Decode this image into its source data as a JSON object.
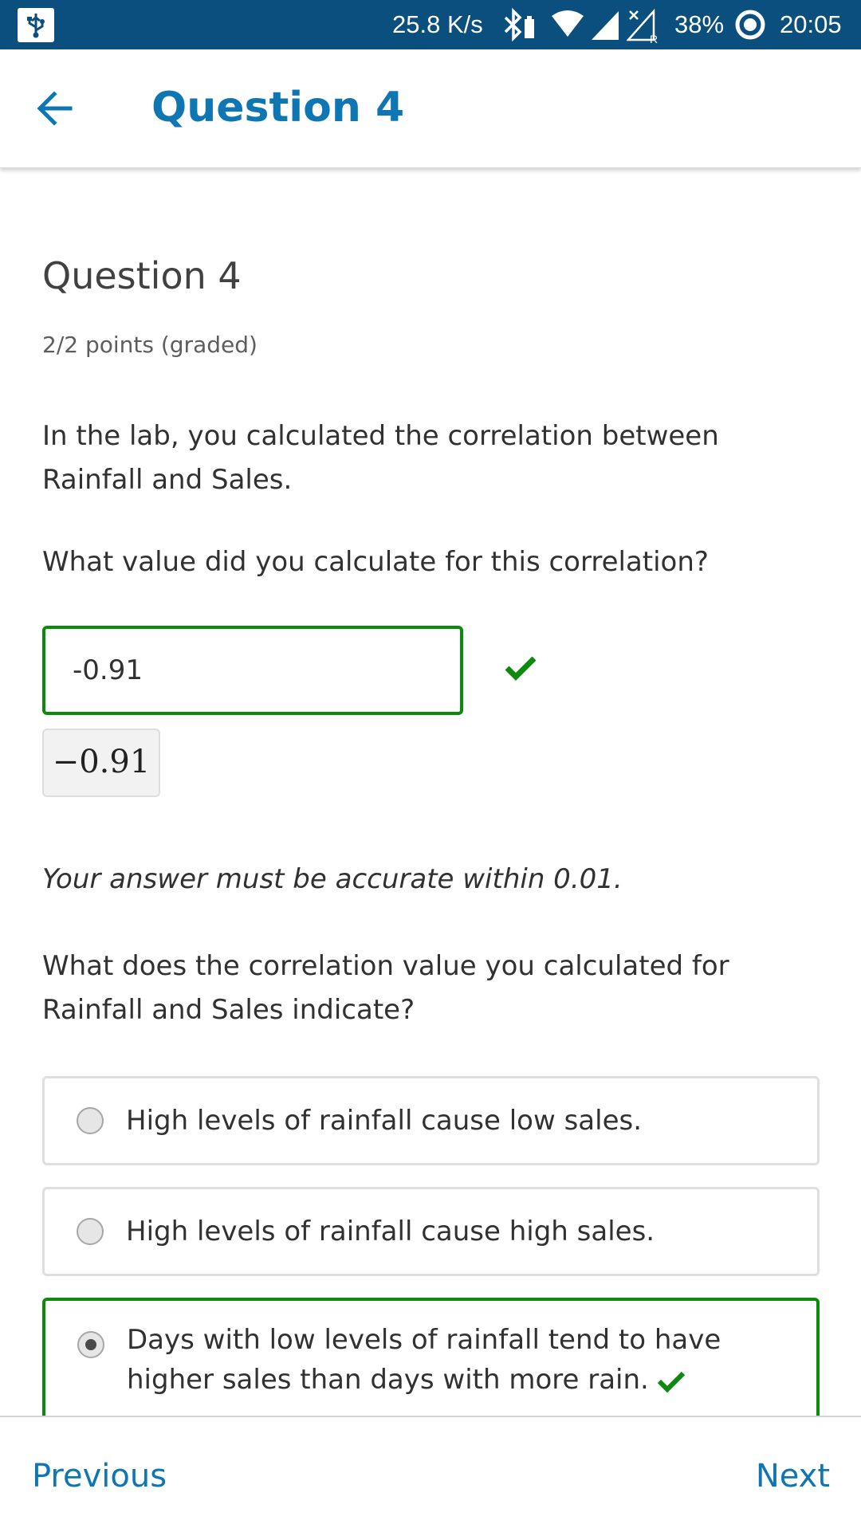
{
  "status_bar": {
    "network_speed": "25.8 K/s",
    "battery": "38%",
    "time": "20:05",
    "icons": [
      "usb-icon",
      "bluetooth-icon",
      "wifi-icon",
      "signal-icon",
      "signal-roaming-icon",
      "battery-ring-icon"
    ]
  },
  "app_bar": {
    "title": "Question 4",
    "back_icon": "arrow-left-icon"
  },
  "question": {
    "heading": "Question 4",
    "points": "2/2 points (graded)",
    "prompt_1": "In the lab, you calculated the correlation between Rainfall and Sales.",
    "prompt_2": "What value did you calculate for this correlation?",
    "answer_value": "-0.91",
    "answer_preview": "−0.91",
    "answer_status": "correct",
    "accuracy_note": "Your answer must be accurate within 0.01.",
    "prompt_3": "What does the correlation value you calculated for Rainfall and Sales indicate?",
    "options": [
      {
        "label": "High levels of rainfall cause low sales.",
        "selected": false
      },
      {
        "label": "High levels of rainfall cause high sales.",
        "selected": false
      },
      {
        "label": "Days with low levels of rainfall tend to have higher sales than days with more rain.",
        "selected": true,
        "correct": true
      }
    ]
  },
  "nav": {
    "previous": "Previous",
    "next": "Next"
  },
  "colors": {
    "status_bar": "#0b4f7e",
    "accent": "#0f76b4",
    "correct": "#0c8a0c"
  }
}
